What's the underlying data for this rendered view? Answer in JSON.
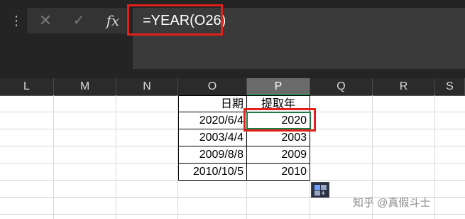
{
  "formula_bar": {
    "more_icon": "⋮",
    "cancel_icon": "✕",
    "enter_icon": "✓",
    "fx_label": "fx",
    "formula": "=YEAR(O26)"
  },
  "columns": [
    "L",
    "M",
    "N",
    "O",
    "P",
    "Q",
    "R",
    "S"
  ],
  "selected_column": "P",
  "table": {
    "headers": [
      "日期",
      "提取年"
    ],
    "rows": [
      [
        "2020/6/4",
        "2020"
      ],
      [
        "2003/4/4",
        "2003"
      ],
      [
        "2009/8/8",
        "2009"
      ],
      [
        "2010/10/5",
        "2010"
      ]
    ]
  },
  "watermark": "知乎 @真假斗士",
  "accent_colors": {
    "highlight_red": "#e2201c",
    "selection_green": "#1f7a45"
  }
}
